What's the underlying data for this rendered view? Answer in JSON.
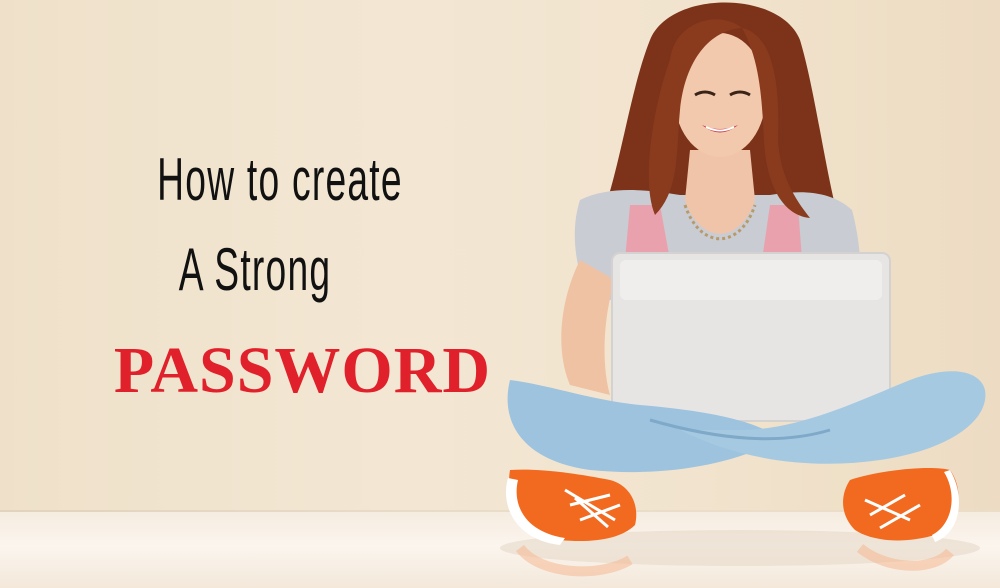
{
  "headline": {
    "line1": "How to create",
    "line2": "A Strong",
    "line3": "PASSWORD"
  },
  "colors": {
    "headline_dark": "#111111",
    "headline_accent": "#e0202a",
    "wall": "#f1e4cf",
    "laptop": "#e7e5e4",
    "jeans": "#9dc3df",
    "sneaker": "#f26a1f",
    "hair": "#8a3b1e"
  },
  "scene_elements": [
    "woman-sitting-cross-legged",
    "laptop",
    "orange-sneakers"
  ]
}
